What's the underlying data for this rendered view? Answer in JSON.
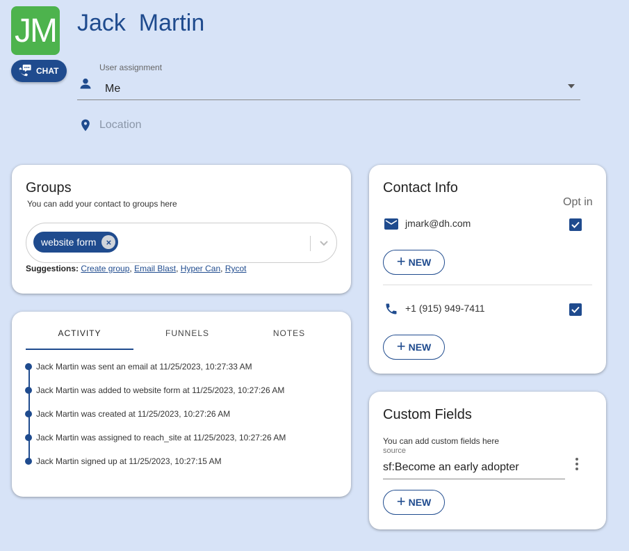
{
  "header": {
    "initials": "JM",
    "name": "Jack  Martin",
    "chat_label": "CHAT",
    "avatar_color": "#4db34d",
    "accent_color": "#1f4b8e"
  },
  "assignment": {
    "label": "User assignment",
    "value": "Me"
  },
  "location": {
    "placeholder": "Location",
    "value": ""
  },
  "groups": {
    "title": "Groups",
    "subtitle": "You can add your contact to groups here",
    "chips": [
      "website form"
    ],
    "suggestions_label": "Suggestions:",
    "suggestions": [
      "Create group",
      "Email Blast",
      "Hyper Can",
      "Rycot"
    ]
  },
  "activity": {
    "tabs": [
      "ACTIVITY",
      "FUNNELS",
      "NOTES"
    ],
    "active_tab": "ACTIVITY",
    "items": [
      "Jack Martin was sent an email at 11/25/2023, 10:27:33 AM",
      "Jack Martin was added to website form at 11/25/2023, 10:27:26 AM",
      "Jack Martin was created at 11/25/2023, 10:27:26 AM",
      "Jack Martin was assigned to reach_site at 11/25/2023, 10:27:26 AM",
      "Jack Martin signed up at 11/25/2023, 10:27:15 AM"
    ]
  },
  "contact": {
    "title": "Contact Info",
    "opt_in_label": "Opt in",
    "email": "jmark@dh.com",
    "email_opt_in": true,
    "phone": "+1 (915) 949-7411",
    "phone_opt_in": true,
    "new_label": "NEW"
  },
  "custom_fields": {
    "title": "Custom Fields",
    "subtitle": "You can add custom fields here",
    "field_label": "source",
    "field_value": "sf:Become an early adopter",
    "new_label": "NEW"
  }
}
